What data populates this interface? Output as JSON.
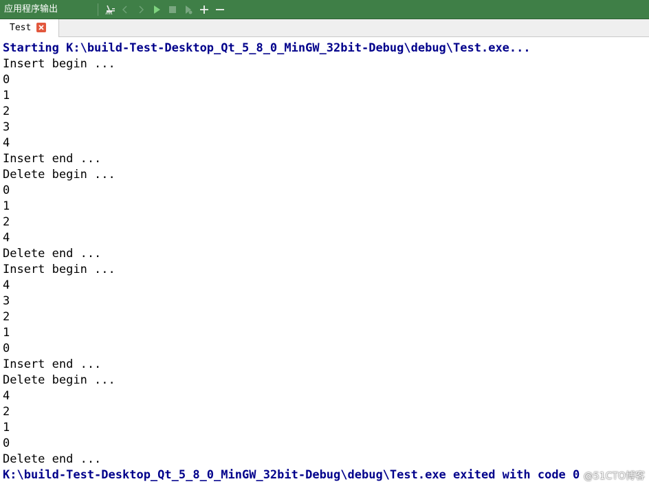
{
  "toolbar": {
    "title": "应用程序输出",
    "buttons": [
      {
        "icon": "clear-output-icon"
      },
      {
        "icon": "previous-icon"
      },
      {
        "icon": "next-icon"
      },
      {
        "icon": "run-icon"
      },
      {
        "icon": "stop-icon"
      },
      {
        "icon": "attach-debugger-icon"
      },
      {
        "icon": "zoom-in-icon"
      },
      {
        "icon": "zoom-out-icon"
      }
    ]
  },
  "tabs": [
    {
      "label": "Test",
      "active": true
    }
  ],
  "output": {
    "lines": [
      {
        "text": "Starting K:\\build-Test-Desktop_Qt_5_8_0_MinGW_32bit-Debug\\debug\\Test.exe...",
        "status": true
      },
      {
        "text": "Insert begin ..."
      },
      {
        "text": "0"
      },
      {
        "text": "1"
      },
      {
        "text": "2"
      },
      {
        "text": "3"
      },
      {
        "text": "4"
      },
      {
        "text": "Insert end ..."
      },
      {
        "text": "Delete begin ..."
      },
      {
        "text": "0"
      },
      {
        "text": "1"
      },
      {
        "text": "2"
      },
      {
        "text": "4"
      },
      {
        "text": "Delete end ..."
      },
      {
        "text": "Insert begin ..."
      },
      {
        "text": "4"
      },
      {
        "text": "3"
      },
      {
        "text": "2"
      },
      {
        "text": "1"
      },
      {
        "text": "0"
      },
      {
        "text": "Insert end ..."
      },
      {
        "text": "Delete begin ..."
      },
      {
        "text": "4"
      },
      {
        "text": "2"
      },
      {
        "text": "1"
      },
      {
        "text": "0"
      },
      {
        "text": "Delete end ..."
      },
      {
        "text": "K:\\build-Test-Desktop_Qt_5_8_0_MinGW_32bit-Debug\\debug\\Test.exe exited with code 0",
        "status": true
      }
    ]
  },
  "watermark": "@51CTO博客",
  "colors": {
    "toolbar_bg": "#3f7f47",
    "status_text": "#00008b",
    "tab_close": "#e2583e"
  }
}
